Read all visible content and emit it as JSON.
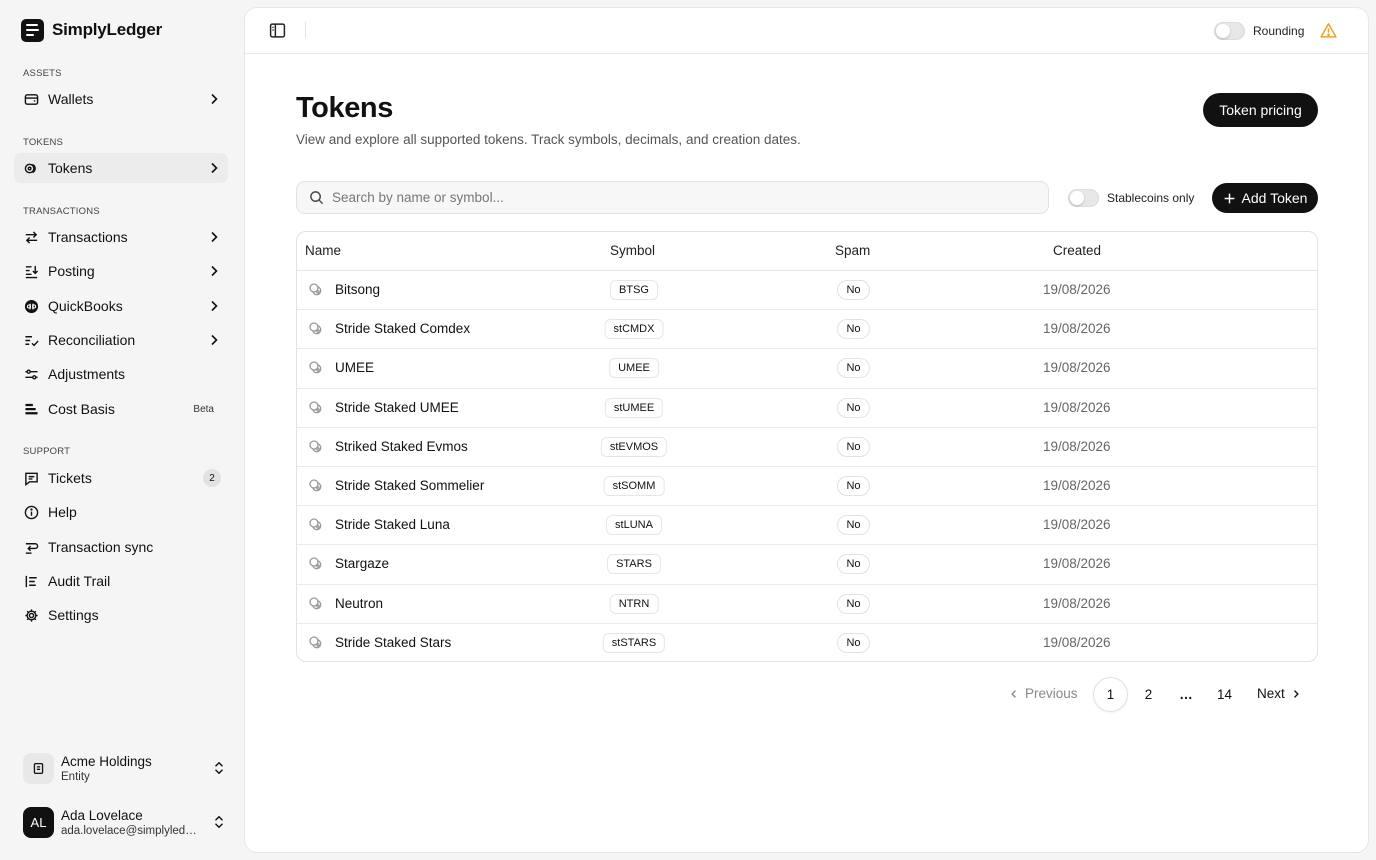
{
  "brand": {
    "name": "SimplyLedger"
  },
  "sidebar": {
    "sections": {
      "assets": "ASSETS",
      "tokens": "TOKENS",
      "transactions": "TRANSACTIONS",
      "support": "SUPPORT"
    },
    "items": {
      "wallets": "Wallets",
      "tokens": "Tokens",
      "transactions": "Transactions",
      "posting": "Posting",
      "quickbooks": "QuickBooks",
      "reconciliation": "Reconciliation",
      "adjustments": "Adjustments",
      "cost_basis": "Cost Basis",
      "cost_basis_badge": "Beta",
      "tickets": "Tickets",
      "tickets_count": "2",
      "help": "Help",
      "transaction_sync": "Transaction sync",
      "audit_trail": "Audit Trail",
      "settings": "Settings"
    },
    "active": "tokens",
    "entity": {
      "name": "Acme Holdings",
      "type": "Entity"
    },
    "user": {
      "initials": "AL",
      "name": "Ada Lovelace",
      "email": "ada.lovelace@simplyledger.com"
    }
  },
  "topbar": {
    "rounding_label": "Rounding",
    "rounding_on": false
  },
  "page": {
    "title": "Tokens",
    "subtitle": "View and explore all supported tokens. Track symbols, decimals, and creation dates.",
    "token_pricing_label": "Token pricing",
    "search_placeholder": "Search by name or symbol...",
    "stablecoins_label": "Stablecoins only",
    "stablecoins_on": false,
    "add_token_label": "Add Token"
  },
  "table": {
    "headers": {
      "name": "Name",
      "symbol": "Symbol",
      "spam": "Spam",
      "created": "Created"
    },
    "rows": [
      {
        "name": "Bitsong",
        "symbol": "BTSG",
        "spam": "No",
        "created": "19/08/2026"
      },
      {
        "name": "Stride Staked Comdex",
        "symbol": "stCMDX",
        "spam": "No",
        "created": "19/08/2026"
      },
      {
        "name": "UMEE",
        "symbol": "UMEE",
        "spam": "No",
        "created": "19/08/2026"
      },
      {
        "name": "Stride Staked UMEE",
        "symbol": "stUMEE",
        "spam": "No",
        "created": "19/08/2026"
      },
      {
        "name": "Striked Staked Evmos",
        "symbol": "stEVMOS",
        "spam": "No",
        "created": "19/08/2026"
      },
      {
        "name": "Stride Staked Sommelier",
        "symbol": "stSOMM",
        "spam": "No",
        "created": "19/08/2026"
      },
      {
        "name": "Stride Staked Luna",
        "symbol": "stLUNA",
        "spam": "No",
        "created": "19/08/2026"
      },
      {
        "name": "Stargaze",
        "symbol": "STARS",
        "spam": "No",
        "created": "19/08/2026"
      },
      {
        "name": "Neutron",
        "symbol": "NTRN",
        "spam": "No",
        "created": "19/08/2026"
      },
      {
        "name": "Stride Staked Stars",
        "symbol": "stSTARS",
        "spam": "No",
        "created": "19/08/2026"
      }
    ]
  },
  "pagination": {
    "previous": "Previous",
    "pages": [
      "1",
      "2",
      "14"
    ],
    "ellipsis": "…",
    "current": "1",
    "next": "Next"
  },
  "colors": {
    "accent": "#111111",
    "warning": "#f0a020"
  },
  "icons": {
    "sidebar_toggle": "sidebar-panel-icon",
    "warning": "warning-triangle-icon",
    "token": "token-coins-icon",
    "search": "search-icon"
  }
}
